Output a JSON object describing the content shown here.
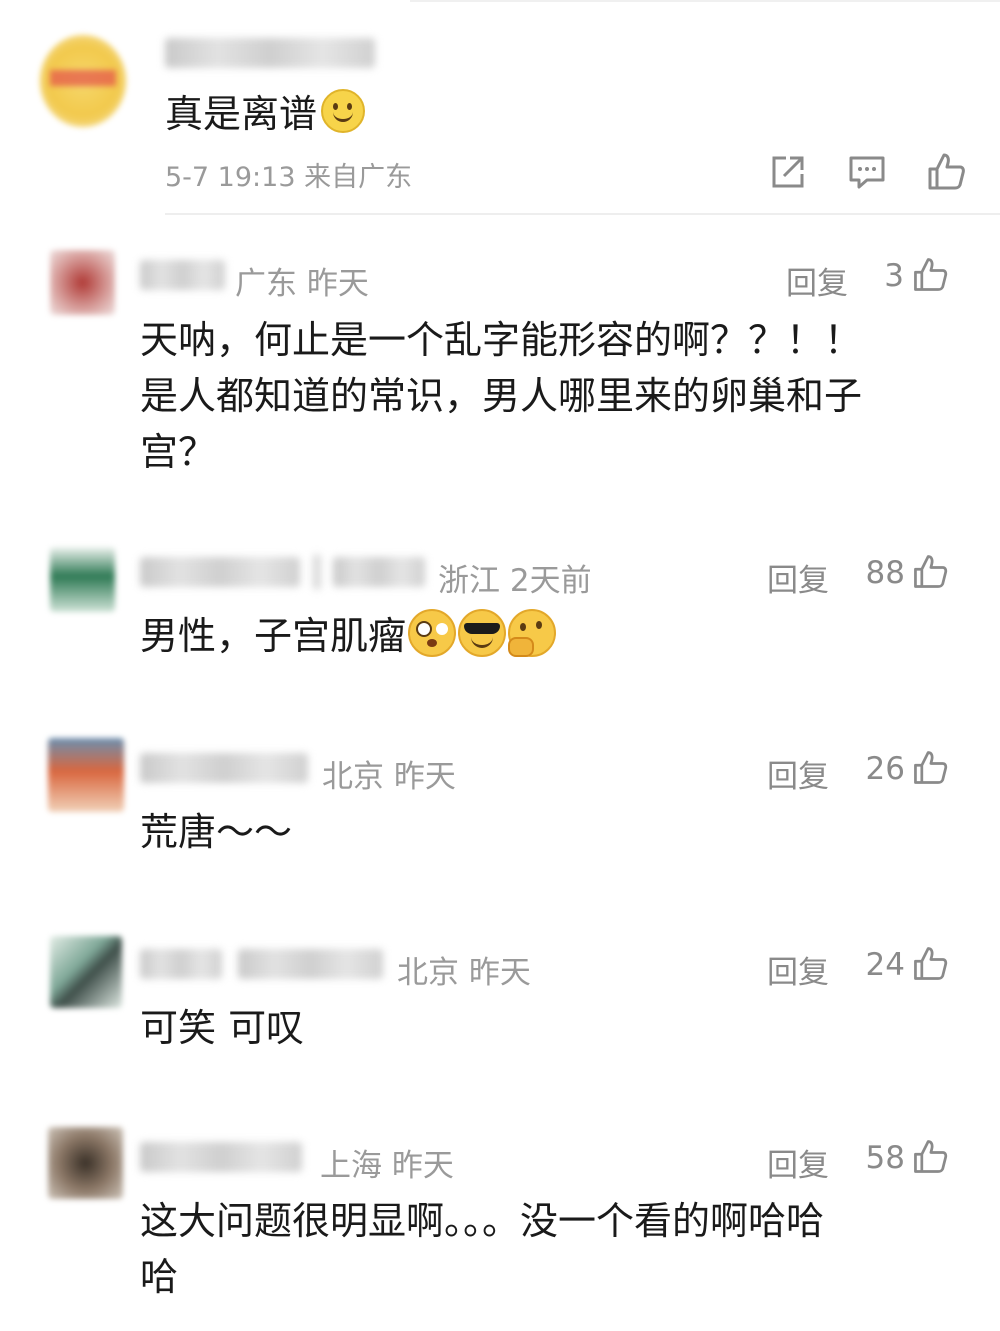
{
  "post": {
    "text": "真是离谱",
    "emoji": "slightly-smiling-emoji-icon",
    "time": "5-7 19:13",
    "source": "来自广东",
    "actions": [
      "share-icon",
      "comment-icon",
      "like-icon"
    ]
  },
  "comments": [
    {
      "location": "广东",
      "time": "昨天",
      "reply": "回复",
      "likes": "3",
      "lines": [
        "天呐，何止是一个乱字能形容的啊？？！！",
        "是人都知道的常识，男人哪里来的卵巢和子",
        "宫？"
      ]
    },
    {
      "location": "浙江",
      "time": "2天前",
      "reply": "回复",
      "likes": "88",
      "lines": [
        "男性，子宫肌瘤"
      ],
      "emojis": [
        "flushed-emoji-icon",
        "sunglasses-emoji-icon",
        "thinking-emoji-icon"
      ]
    },
    {
      "location": "北京",
      "time": "昨天",
      "reply": "回复",
      "likes": "26",
      "lines": [
        "荒唐～～"
      ]
    },
    {
      "location": "北京",
      "time": "昨天",
      "reply": "回复",
      "likes": "24",
      "lines": [
        "可笑 可叹"
      ]
    },
    {
      "location": "上海",
      "time": "昨天",
      "reply": "回复",
      "likes": "58",
      "lines": [
        "这大问题很明显啊。。。没一个看的啊哈哈",
        "哈"
      ]
    }
  ],
  "colors": {
    "text": "#1a1a1a",
    "meta": "#9a9a9a",
    "divider": "#eeeeee"
  }
}
